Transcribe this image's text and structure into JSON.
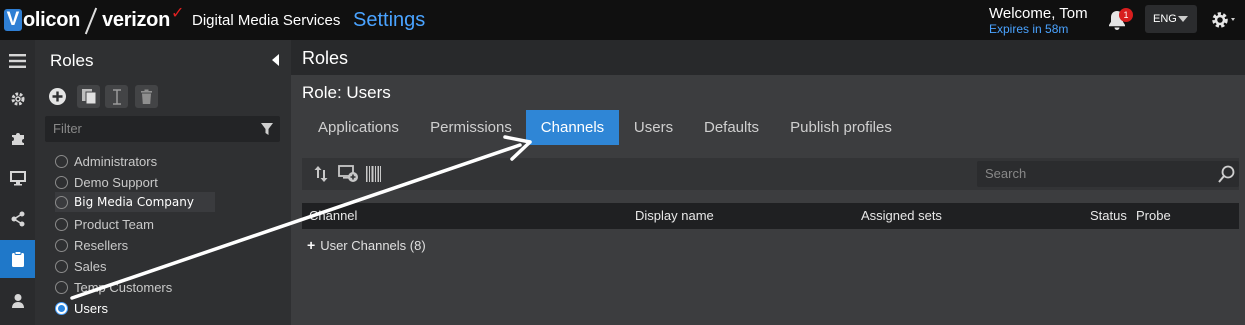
{
  "header": {
    "logo_v": "V",
    "logo_brand1": "olicon",
    "logo_brand2": "verizon",
    "logo_check": "✓",
    "product": "Digital Media Services",
    "section": "Settings",
    "welcome": "Welcome, Tom",
    "expires": "Expires in 58m",
    "notification_count": "1",
    "language": "ENG",
    "accent_color": "#4aa3ff",
    "badge_color": "#d81e1e"
  },
  "left_nav": {
    "items": [
      {
        "icon": "menu-icon"
      },
      {
        "icon": "gear-icon"
      },
      {
        "icon": "puzzle-icon"
      },
      {
        "icon": "monitor-icon"
      },
      {
        "icon": "share-icon"
      },
      {
        "icon": "clipboard-icon",
        "active": true
      },
      {
        "icon": "user-icon"
      }
    ],
    "active_color": "#1f78c9"
  },
  "roles_panel": {
    "title": "Roles",
    "tools": [
      "add-icon",
      "copy-icon",
      "rename-icon",
      "delete-icon"
    ],
    "filter_placeholder": "Filter",
    "roles": [
      {
        "label": "Administrators",
        "selected": false
      },
      {
        "label": "Demo Support",
        "selected": false
      },
      {
        "label": "Big Media Company",
        "selected": false
      },
      {
        "label": "Product Team",
        "selected": false
      },
      {
        "label": "Resellers",
        "selected": false
      },
      {
        "label": "Sales",
        "selected": false
      },
      {
        "label": "Temp Customers",
        "selected": false
      },
      {
        "label": "Users",
        "selected": true
      }
    ]
  },
  "main": {
    "title": "Roles",
    "role_name": "Role: Users",
    "tabs": [
      {
        "label": "Applications"
      },
      {
        "label": "Permissions"
      },
      {
        "label": "Channels",
        "active": true
      },
      {
        "label": "Users"
      },
      {
        "label": "Defaults"
      },
      {
        "label": "Publish profiles"
      }
    ],
    "toolbar_icons": [
      "sort-icon",
      "add-device-icon",
      "barcode-icon"
    ],
    "search_placeholder": "Search",
    "columns": [
      "Channel",
      "Display name",
      "Assigned sets",
      "Status",
      "Probe"
    ],
    "group_row": "User Channels (8)"
  }
}
